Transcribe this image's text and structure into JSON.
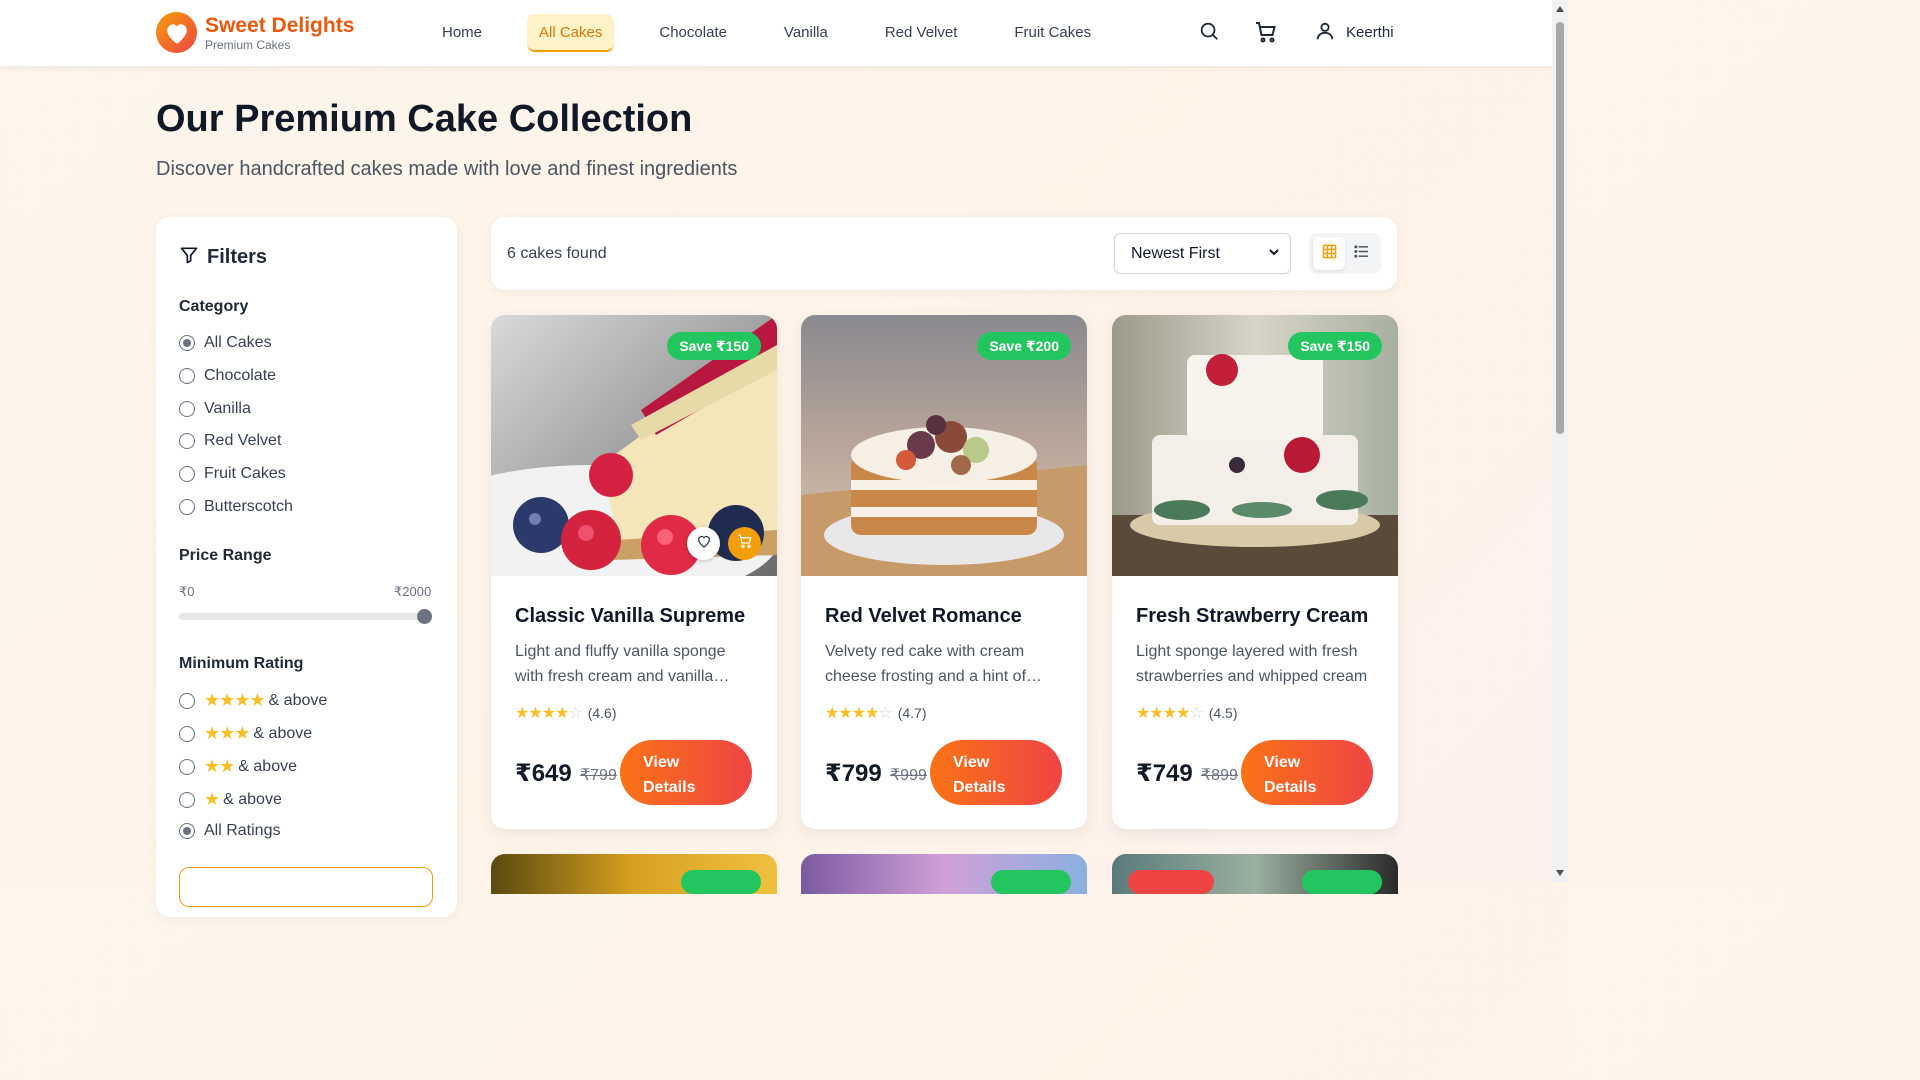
{
  "brand": {
    "name": "Sweet Delights",
    "tagline": "Premium Cakes"
  },
  "nav": [
    {
      "label": "Home",
      "active": false
    },
    {
      "label": "All Cakes",
      "active": true
    },
    {
      "label": "Chocolate",
      "active": false
    },
    {
      "label": "Vanilla",
      "active": false
    },
    {
      "label": "Red Velvet",
      "active": false
    },
    {
      "label": "Fruit Cakes",
      "active": false
    }
  ],
  "user": {
    "name": "Keerthi"
  },
  "hero": {
    "title": "Our Premium Cake Collection",
    "subtitle": "Discover handcrafted cakes made with love and finest ingredients"
  },
  "filters": {
    "title": "Filters",
    "category_label": "Category",
    "categories": [
      "All Cakes",
      "Chocolate",
      "Vanilla",
      "Red Velvet",
      "Fruit Cakes",
      "Butterscotch"
    ],
    "selected_category": "All Cakes",
    "price_label": "Price Range",
    "price_min": "₹0",
    "price_max": "₹2000",
    "price_value_fraction": 1.0,
    "rating_label": "Minimum Rating",
    "ratings": [
      {
        "stars": "★★★★",
        "label": "& above"
      },
      {
        "stars": "★★★",
        "label": "& above"
      },
      {
        "stars": "★★",
        "label": "& above"
      },
      {
        "stars": "★",
        "label": "& above"
      }
    ],
    "all_ratings_label": "All Ratings",
    "selected_rating": "All Ratings"
  },
  "toolbar": {
    "count": "6 cakes found",
    "sort_value": "Newest First",
    "view_mode": "grid"
  },
  "cards": [
    {
      "badge": "Save ₹150",
      "title": "Classic Vanilla Supreme",
      "desc": "Light and fluffy vanilla sponge with fresh cream and vanilla…",
      "rating": "(4.6)",
      "stars_filled": 4,
      "price": "₹649",
      "old_price": "₹799",
      "button": "View Details"
    },
    {
      "badge": "Save ₹200",
      "title": "Red Velvet Romance",
      "desc": "Velvety red cake with cream cheese frosting and a hint of…",
      "rating": "(4.7)",
      "stars_filled": 4,
      "price": "₹799",
      "old_price": "₹999",
      "button": "View Details"
    },
    {
      "badge": "Save ₹150",
      "title": "Fresh Strawberry Cream",
      "desc": "Light sponge layered with fresh strawberries and whipped cream",
      "rating": "(4.5)",
      "stars_filled": 4,
      "price": "₹749",
      "old_price": "₹899",
      "button": "View Details"
    }
  ],
  "colors": {
    "accent": "#f59e0b",
    "brand": "#ea580c",
    "save_badge": "#22c55e",
    "cta_start": "#f97316",
    "cta_end": "#ef4444"
  }
}
